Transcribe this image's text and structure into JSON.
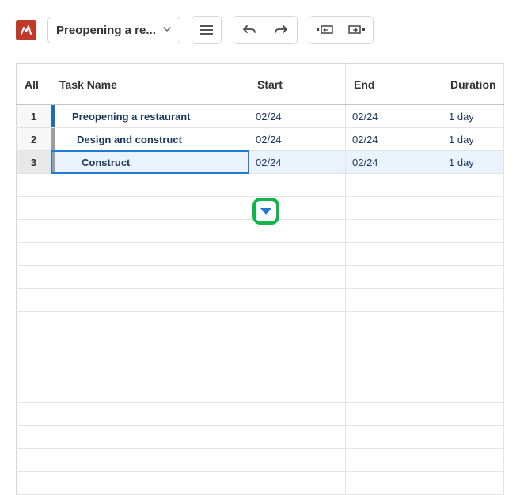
{
  "header": {
    "doc_title": "Preopening a re..."
  },
  "columns": {
    "all": "All",
    "task": "Task Name",
    "start": "Start",
    "end": "End",
    "duration": "Duration"
  },
  "rows": [
    {
      "num": "1",
      "task": "Preopening a restaurant",
      "indent": 1,
      "handle": "blue",
      "start": "02/24",
      "end": "02/24",
      "duration": "1 day",
      "selected": false
    },
    {
      "num": "2",
      "task": "Design and construct",
      "indent": 2,
      "handle": "gray",
      "start": "02/24",
      "end": "02/24",
      "duration": "1 day",
      "selected": false
    },
    {
      "num": "3",
      "task": "Construct",
      "indent": 3,
      "handle": "gray",
      "start": "02/24",
      "end": "02/24",
      "duration": "1 day",
      "selected": true
    }
  ],
  "empty_rows": 14
}
